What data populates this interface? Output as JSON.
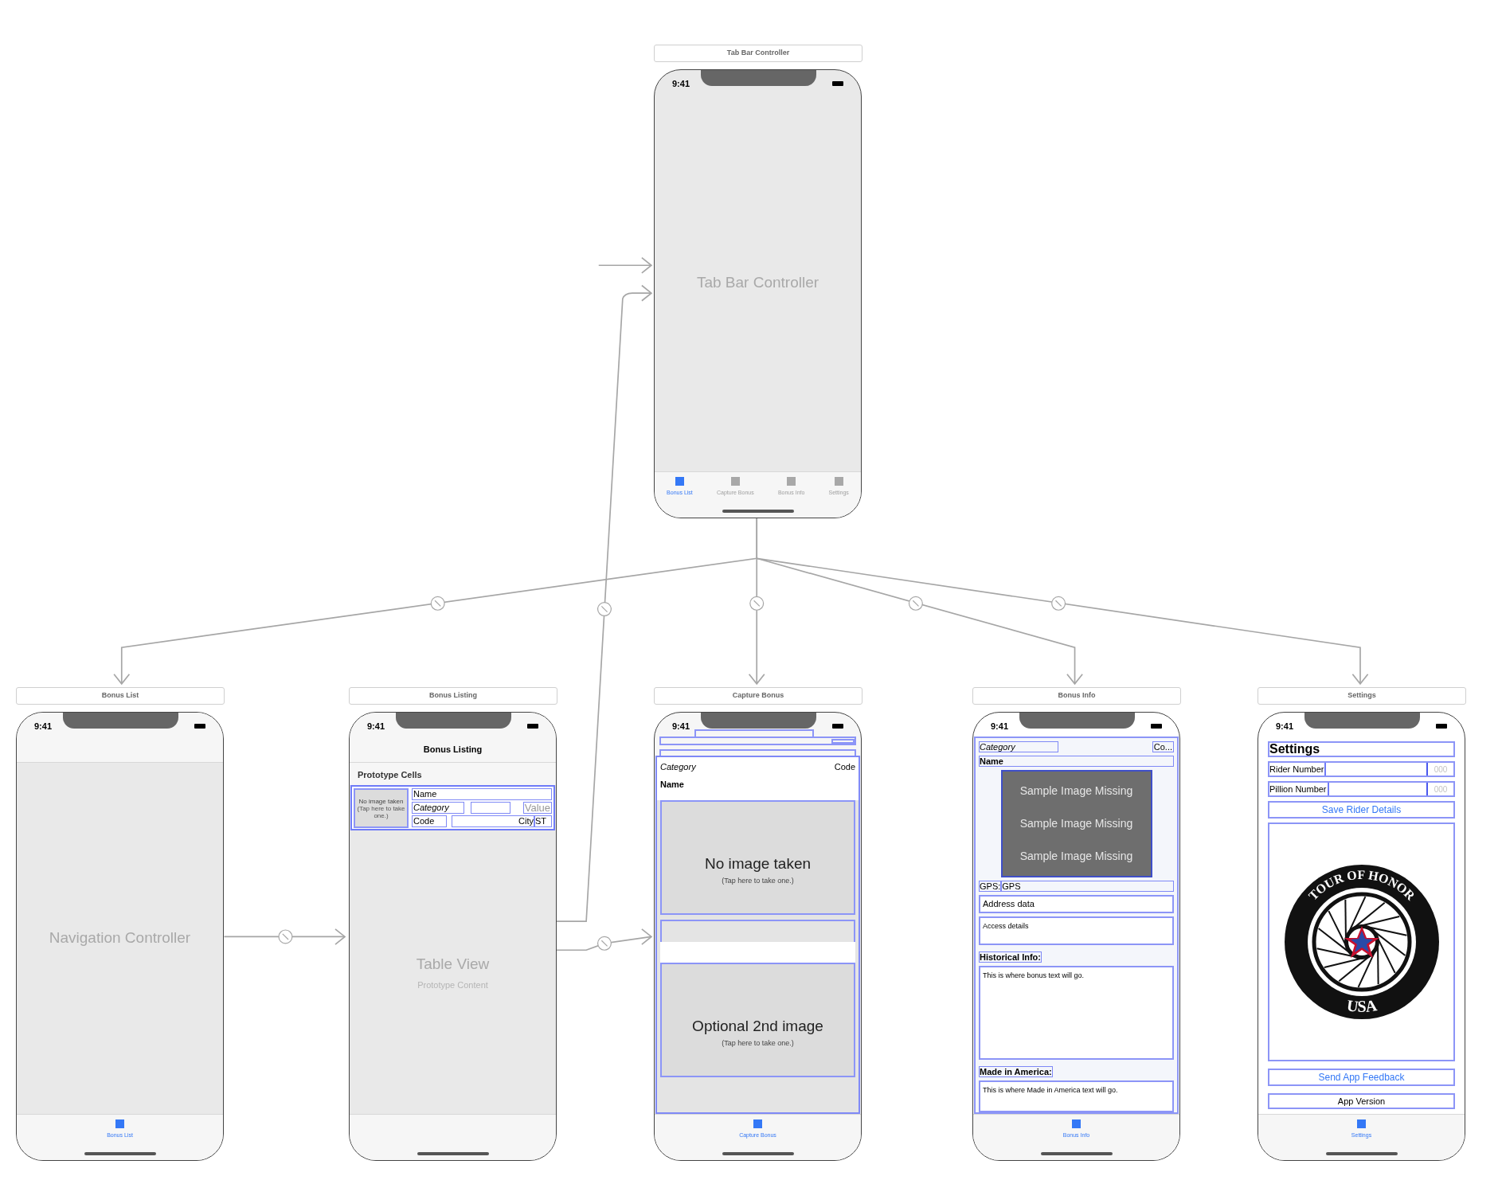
{
  "scenes": [
    {
      "kind": "tab_bar_controller",
      "title": "Tab Bar Controller",
      "time": "9:41",
      "center_label": "Tab Bar Controller",
      "tabs": [
        {
          "label": "Bonus List",
          "selected": true
        },
        {
          "label": "Capture Bonus",
          "selected": false
        },
        {
          "label": "Bonus Info",
          "selected": false
        },
        {
          "label": "Settings",
          "selected": false
        }
      ]
    },
    {
      "kind": "navigation_controller",
      "title": "Bonus List",
      "time": "9:41",
      "center_label": "Navigation Controller",
      "tabs": [
        {
          "label": "Bonus List",
          "selected": true
        }
      ]
    },
    {
      "kind": "table_view",
      "title": "Bonus Listing",
      "time": "9:41",
      "nav_title": "Bonus Listing",
      "section_header": "Prototype Cells",
      "cell": {
        "thumb_title": "No image taken",
        "thumb_hint": "(Tap here to take one.)",
        "name": "Name",
        "category": "Category",
        "value": "Value",
        "code": "Code",
        "city": "City",
        "state": "ST"
      },
      "center_label": "Table View",
      "center_sublabel": "Prototype Content"
    },
    {
      "kind": "capture",
      "title": "Capture Bonus",
      "time": "9:41",
      "category": "Category",
      "code": "Code",
      "name": "Name",
      "image1": {
        "title": "No image taken",
        "hint": "(Tap here to take one.)"
      },
      "image2": {
        "title": "Optional 2nd image",
        "hint": "(Tap here to take one.)"
      },
      "tabs": [
        {
          "label": "Capture Bonus",
          "selected": true
        }
      ]
    },
    {
      "kind": "info",
      "title": "Bonus Info",
      "time": "9:41",
      "category": "Category",
      "code": "Co...",
      "name": "Name",
      "image_lines": [
        "Sample Image Missing",
        "Sample Image Missing",
        "Sample Image Missing"
      ],
      "gps_label": "GPS:",
      "gps_value": "GPS",
      "address": "Address data",
      "access": "Access details",
      "historical_label": "Historical Info:",
      "historical_text": "This is where bonus text will go.",
      "made_label": "Made in America:",
      "made_text": "This is where Made in America text will go.",
      "tabs": [
        {
          "label": "Bonus Info",
          "selected": true
        }
      ]
    },
    {
      "kind": "settings",
      "title": "Settings",
      "time": "9:41",
      "heading": "Settings",
      "fields": [
        {
          "label": "Rider Number",
          "placeholder": "000"
        },
        {
          "label": "Pillion Number",
          "placeholder": "000"
        }
      ],
      "save_button": "Save Rider Details",
      "logo": {
        "top_text": "TOUR OF HONOR",
        "bottom_text": "USA"
      },
      "feedback_button": "Send App Feedback",
      "version_label": "App Version",
      "tabs": [
        {
          "label": "Settings",
          "selected": true
        }
      ]
    }
  ]
}
